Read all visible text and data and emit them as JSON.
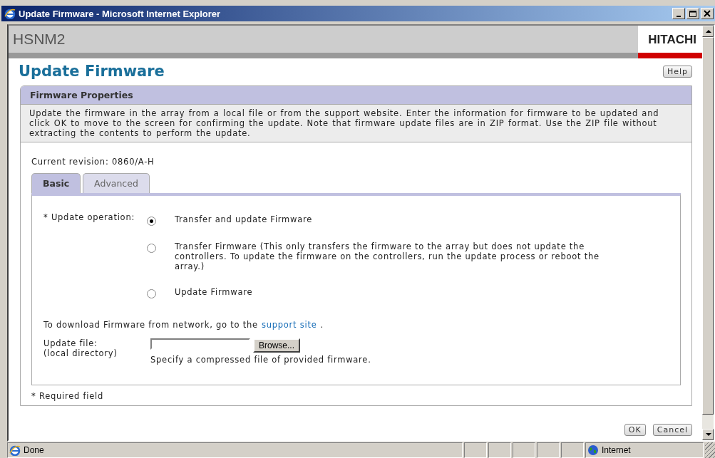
{
  "window": {
    "title": "Update Firmware - Microsoft Internet Explorer"
  },
  "header": {
    "product": "HSNM2",
    "brand": "HITACHI"
  },
  "page": {
    "title": "Update Firmware",
    "help": "Help"
  },
  "panel": {
    "title": "Firmware Properties",
    "description": "Update the firmware in the array from a local file or from the support website.  Enter the information for firmware to be updated and click OK to move to the screen for confirming the update.  Note that firmware update files are in ZIP format. Use the ZIP file without extracting the contents to perform the update.",
    "revision": "Current revision: 0860/A-H",
    "tabs": [
      {
        "label": "Basic",
        "selected": true
      },
      {
        "label": "Advanced",
        "selected": false
      }
    ],
    "operation_label": "* Update operation:",
    "options": [
      {
        "label": "Transfer and update Firmware",
        "selected": true
      },
      {
        "label": "Transfer Firmware (This only transfers the firmware to the array but does not update the controllers. To update the firmware on the controllers, run the update process or reboot the array.)",
        "selected": false
      },
      {
        "label": "Update Firmware",
        "selected": false
      }
    ],
    "download_text": "To download Firmware from network, go to the",
    "download_link": "support site",
    "download_end": ".",
    "file_label": [
      "Update file:",
      "(local directory)"
    ],
    "browse": "Browse...",
    "file_hint": "Specify a compressed file of provided firmware.",
    "required_note": "* Required field"
  },
  "buttons": [
    "OK",
    "Cancel"
  ],
  "status_bar": {
    "status": "Done",
    "zone": "Internet"
  }
}
